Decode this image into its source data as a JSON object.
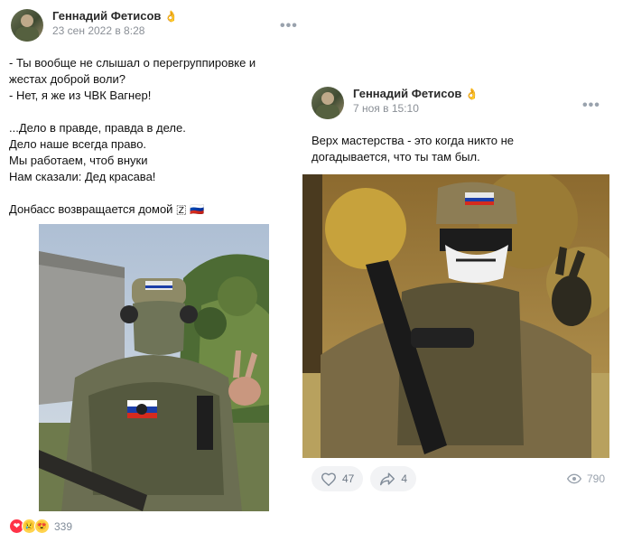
{
  "post1": {
    "author": "Геннадий Фетисов",
    "author_emoji": "👌",
    "date": "23 сен 2022 в 8:28",
    "more": "•••",
    "text": "- Ты вообще не слышал о перегруппировке и\nжестах доброй воли?\n- Нет, я же из ЧВК Вагнер!\n\n...Дело в правде, правда в деле.\nДело наше всегда право.\nМы работаем, чтоб внуки\nНам сказали: Дед красава!\n\nДонбасс возвращается домой 🇿 🇷🇺",
    "reactions": {
      "icons": [
        "❤",
        "😢",
        "😍"
      ],
      "count": "339"
    }
  },
  "post2": {
    "author": "Геннадий Фетисов",
    "author_emoji": "👌",
    "date": "7 ноя в 15:10",
    "more": "•••",
    "text": "Верх мастерства - это когда никто не\nдогадывается, что ты там был.",
    "likes": "47",
    "shares": "4",
    "views": "790"
  },
  "colors": {
    "like_red": "#ff3347",
    "text_gray": "#818c99",
    "pill_bg": "#f2f3f5"
  }
}
